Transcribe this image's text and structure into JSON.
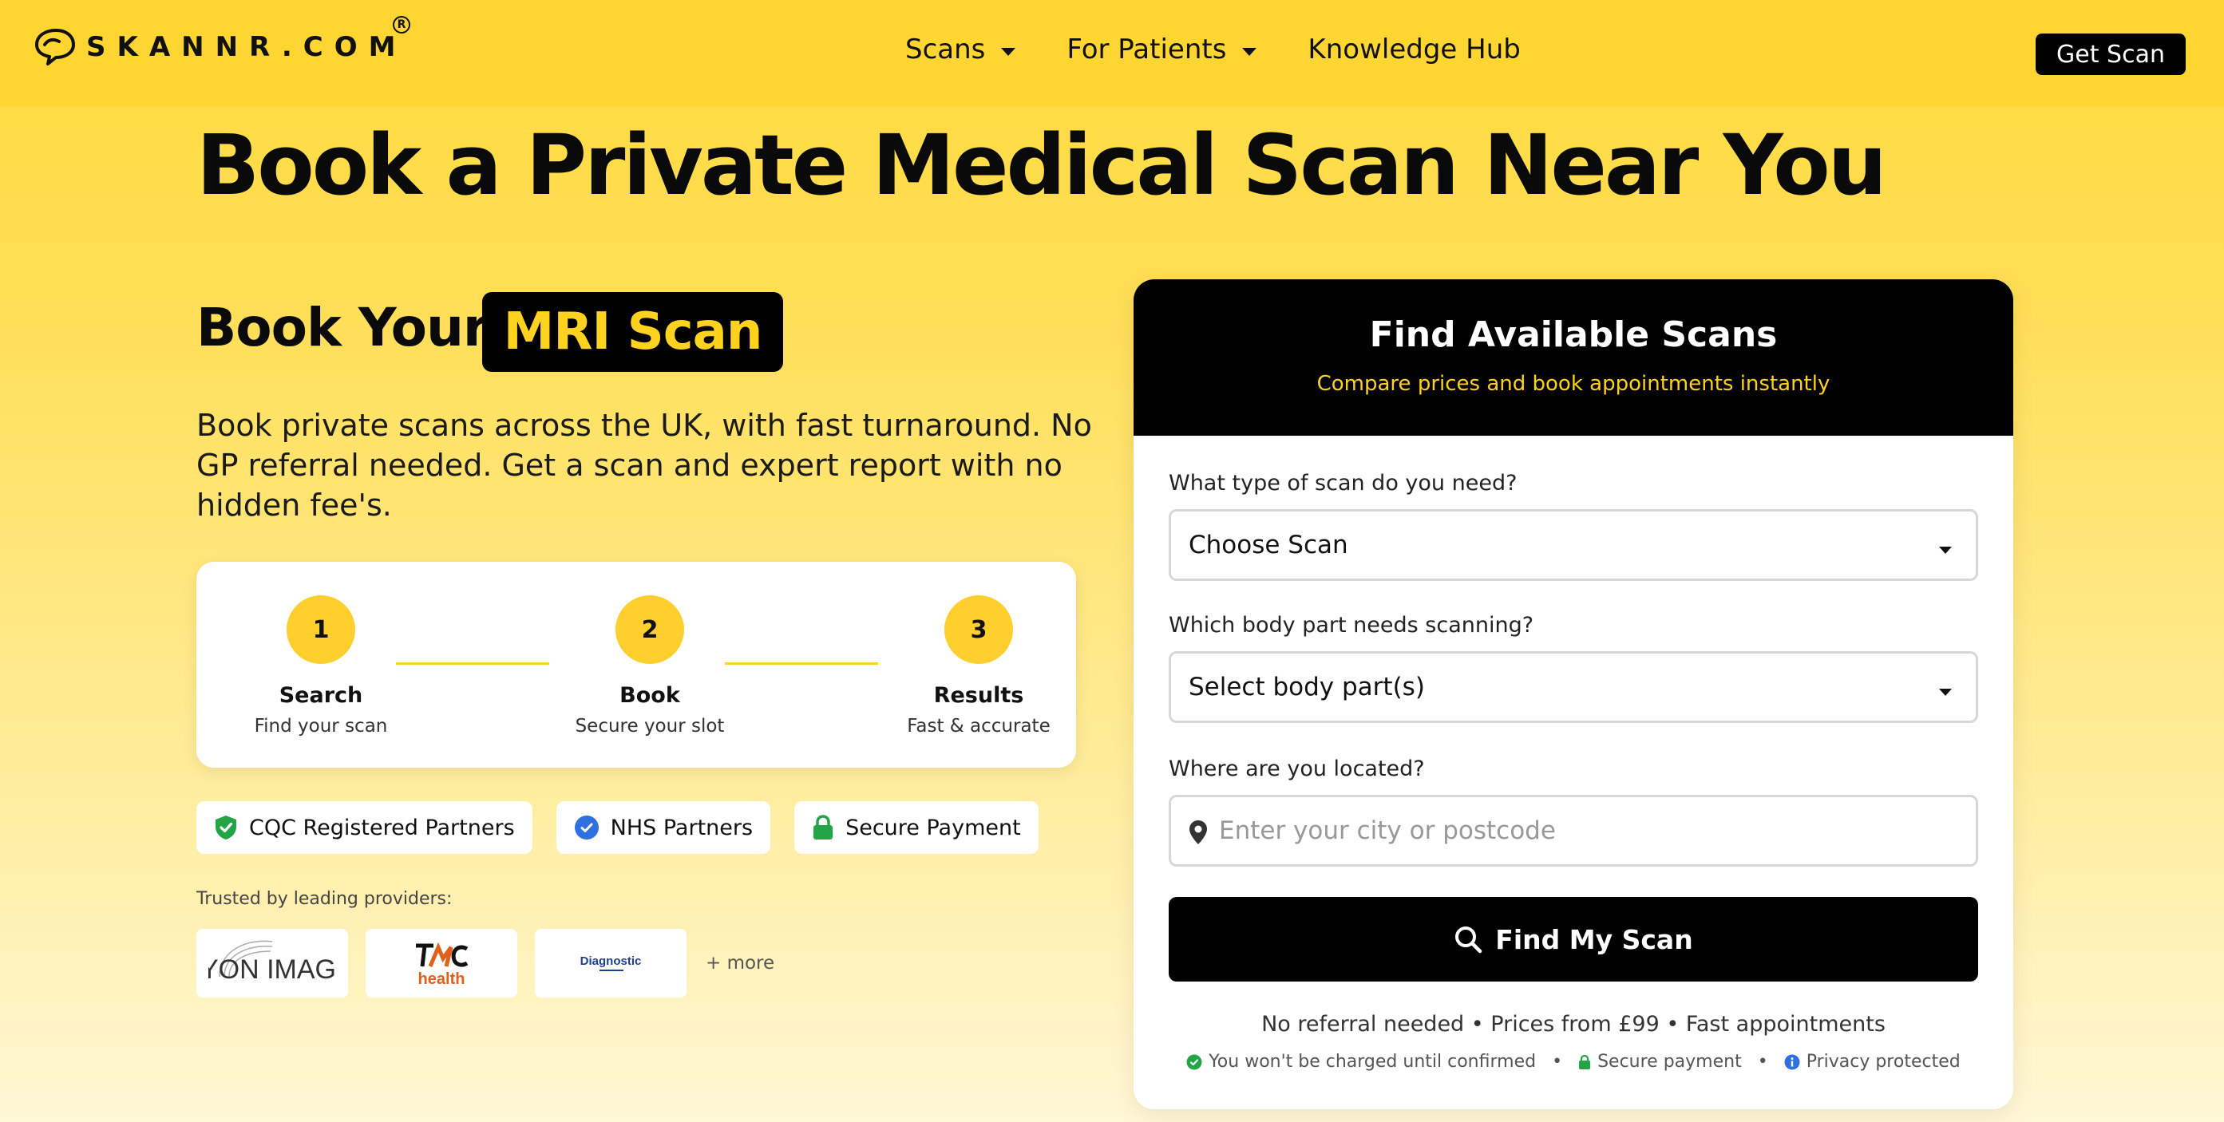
{
  "header": {
    "logo_text": "SKANNR.COM",
    "logo_reg": "R",
    "nav": [
      {
        "label": "Scans",
        "has_dropdown": true
      },
      {
        "label": "For Patients",
        "has_dropdown": true
      },
      {
        "label": "Knowledge Hub",
        "has_dropdown": false
      }
    ],
    "cta_label": "Get Scan"
  },
  "hero": {
    "title": "Book a Private Medical Scan Near You",
    "book_your": "Book Your",
    "highlight": "MRI Scan",
    "description": "Book private scans across the UK, with fast turnaround. No GP referral needed. Get a scan and expert report with no hidden fee's."
  },
  "steps": [
    {
      "number": "1",
      "title": "Search",
      "subtitle": "Find your scan"
    },
    {
      "number": "2",
      "title": "Book",
      "subtitle": "Secure your slot"
    },
    {
      "number": "3",
      "title": "Results",
      "subtitle": "Fast & accurate"
    }
  ],
  "badges": [
    {
      "label": "CQC Registered Partners",
      "icon": "shield-check-icon",
      "color": "#22a447"
    },
    {
      "label": "NHS Partners",
      "icon": "check-circle-icon",
      "color": "#2f6fe0"
    },
    {
      "label": "Secure Payment",
      "icon": "lock-icon",
      "color": "#22a447"
    }
  ],
  "trusted": {
    "label": "Trusted by leading providers:",
    "providers": [
      "ORYON IMAGING",
      "TMC health",
      "Diagnostic"
    ],
    "more_label": "+ more"
  },
  "search_card": {
    "title": "Find Available Scans",
    "subtitle": "Compare prices and book appointments instantly",
    "scan_type_label": "What type of scan do you need?",
    "scan_type_value": "Choose Scan",
    "body_part_label": "Which body part needs scanning?",
    "body_part_value": "Select body part(s)",
    "location_label": "Where are you located?",
    "location_placeholder": "Enter your city or postcode",
    "location_value": "",
    "button_label": "Find My Scan",
    "note": "No referral needed • Prices from £99 • Fast appointments",
    "assurances": [
      {
        "label": "You won't be charged until confirmed",
        "icon": "check-circle-icon",
        "color": "#22a447"
      },
      {
        "label": "Secure payment",
        "icon": "lock-icon",
        "color": "#22a447"
      },
      {
        "label": "Privacy protected",
        "icon": "info-icon",
        "color": "#2f6fe0"
      }
    ]
  },
  "colors": {
    "accent_yellow": "#ffd631",
    "highlight_text": "#ffd21f",
    "dark": "#000000"
  }
}
